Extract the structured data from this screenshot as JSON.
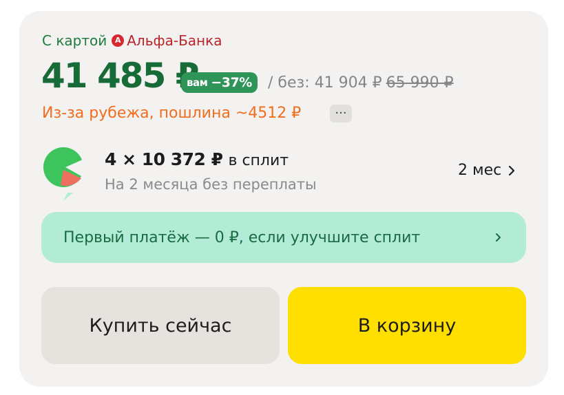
{
  "offer": {
    "card_prefix": "С картой",
    "bank_name": "Альфа-Банка",
    "bank_logo_letter": "A",
    "bank_color": "#d8282f",
    "price": "41 485 ₽",
    "discount_prefix": "вам",
    "discount": "−37%",
    "without_label": "/ без: 41 904 ₽",
    "old_price": "65 990 ₽",
    "duty_text": "Из-за рубежа, пошлина ~4512 ₽",
    "more_label": "···",
    "price_color": "#166b37",
    "duty_color": "#f26d1d"
  },
  "split": {
    "logo_icon": "split-watermelon-icon",
    "amount": "4 × 10 372 ₽",
    "amount_suffix": "в сплит",
    "subtitle": "На 2 месяца без переплаты",
    "term": "2 мес"
  },
  "promo": {
    "text": "Первый платёж — 0 ₽, если улучшите сплит",
    "color": "#b2ecd6"
  },
  "actions": {
    "buy_now": "Купить сейчас",
    "add_to_cart": "В корзину",
    "cart_color": "#ffdf00"
  }
}
